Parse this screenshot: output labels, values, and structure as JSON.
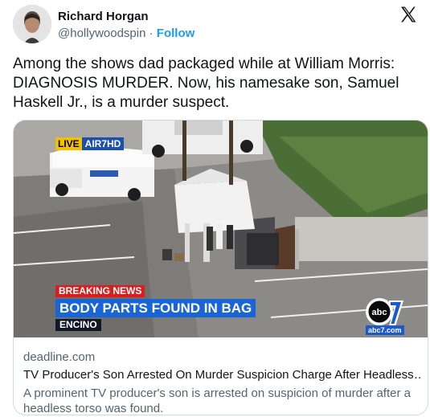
{
  "author": {
    "name": "Richard Horgan",
    "handle": "@hollywoodspin",
    "separator": "·",
    "follow_label": "Follow"
  },
  "tweet": {
    "text": "Among the shows dad packaged while at William Morris: DIAGNOSIS MURDER. Now, his namesake son, Samuel Haskell Jr., is a murder suspect."
  },
  "media": {
    "live_label": "LIVE",
    "source_label": "AIR7HD",
    "breaking_label": "BREAKING NEWS",
    "headline": "BODY PARTS FOUND IN BAG",
    "location": "ENCINO",
    "channel_url": "abc7.com",
    "icons": [
      "x-logo-icon",
      "abc7-logo-icon"
    ]
  },
  "card": {
    "domain": "deadline.com",
    "title": "TV Producer's Son Arrested On Murder Suspicion Charge After Headless…",
    "description": "A prominent TV producer's son is arrested on suspicion of murder after a headless torso was found."
  },
  "colors": {
    "text_primary": "#0f1419",
    "text_secondary": "#536471",
    "follow_blue": "#1d9bf0",
    "breaking_red": "#d91e1e",
    "headline_blue": "#1965d8",
    "live_yellow": "#f2c200"
  }
}
